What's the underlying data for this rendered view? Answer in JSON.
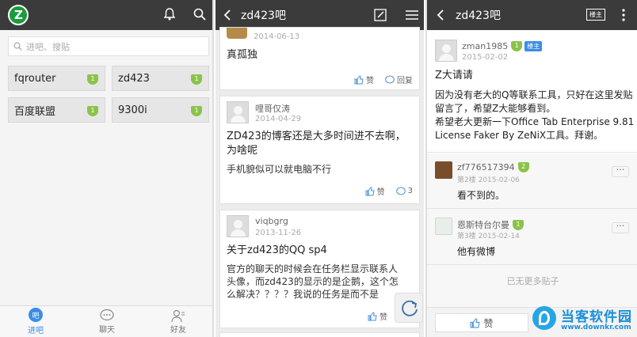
{
  "panel_left": {
    "search_placeholder": "进吧、搜贴",
    "forums": [
      {
        "name": "fqrouter",
        "level": "1"
      },
      {
        "name": "zd423",
        "level": "1"
      },
      {
        "name": "百度联盟",
        "level": "1"
      },
      {
        "name": "9300i",
        "level": "1"
      }
    ],
    "nav": [
      "进吧",
      "聊天",
      "好友"
    ]
  },
  "panel_mid": {
    "title": "zd423吧",
    "posts": [
      {
        "date": "2014-06-13",
        "title": "真孤独",
        "like": "赞",
        "reply": "回复"
      },
      {
        "user": "哩哥仅涛",
        "date": "2014-04-29",
        "title": "ZD423的博客还是大多时间进不去啊，为啥呢",
        "body": "手机貌似可以就电脑不行",
        "like": "赞",
        "reply": "3"
      },
      {
        "user": "viqbgrg",
        "date": "2013-11-26",
        "title": "关于zd423的QQ  sp4",
        "body": "官方的聊天的时候会在任务栏显示联系人头像，而zd423的显示的是企鹅，这个怎么解决？？？？我说的任务是而不是",
        "like": "赞"
      }
    ]
  },
  "panel_right": {
    "title": "zd423吧",
    "host_tag": "楼主",
    "op": {
      "user": "zman1985",
      "level": "1",
      "host_badge": "楼主",
      "date": "2015-02-02",
      "title": "Z大请请",
      "body": "因为没有老大的Q等联系工具，只好在这里发贴留言了，希望Z大能够看到。\n希望老大更新一下Office Tab Enterprise 9.81 License Faker By ZeNiX工具。拜谢。"
    },
    "replies": [
      {
        "user": "zf776517394",
        "level": "2",
        "meta": "第2楼  2015-02-06",
        "text": "看不到的。"
      },
      {
        "user": "恩斯特台尔曼",
        "level": "1",
        "meta": "第3楼  2015-02-14",
        "text": "他有微博"
      }
    ],
    "no_more": "已无更多贴子",
    "like": "赞"
  },
  "watermark": {
    "name": "当客软件园",
    "url": "www.downkr.com"
  }
}
